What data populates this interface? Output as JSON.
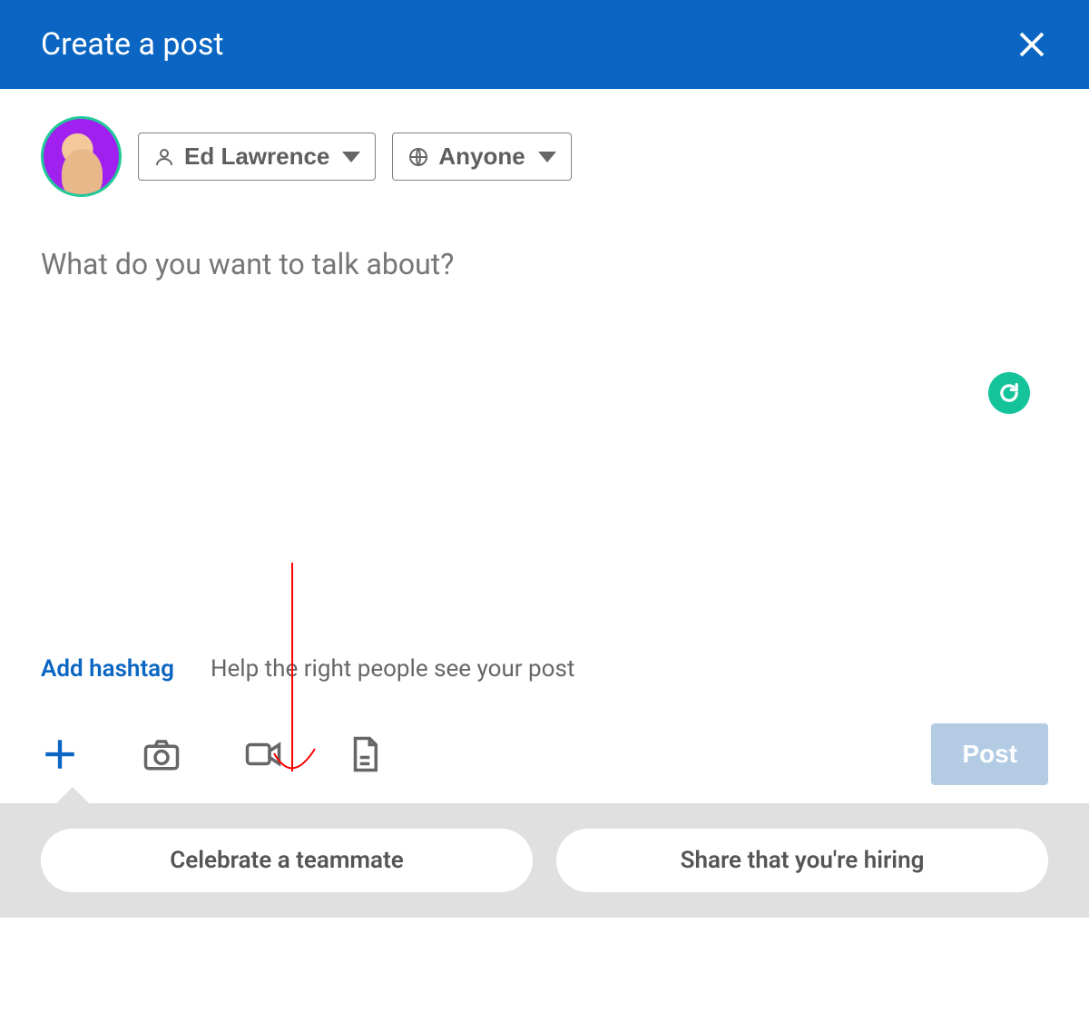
{
  "header": {
    "title": "Create a post"
  },
  "author": {
    "name": "Ed Lawrence",
    "visibility": "Anyone"
  },
  "composer": {
    "placeholder": "What do you want to talk about?"
  },
  "hashtag": {
    "add_label": "Add hashtag",
    "help_text": "Help the right people see your post"
  },
  "actions": {
    "post_label": "Post"
  },
  "suggestions": [
    "Celebrate a teammate",
    "Share that you're hiring"
  ]
}
